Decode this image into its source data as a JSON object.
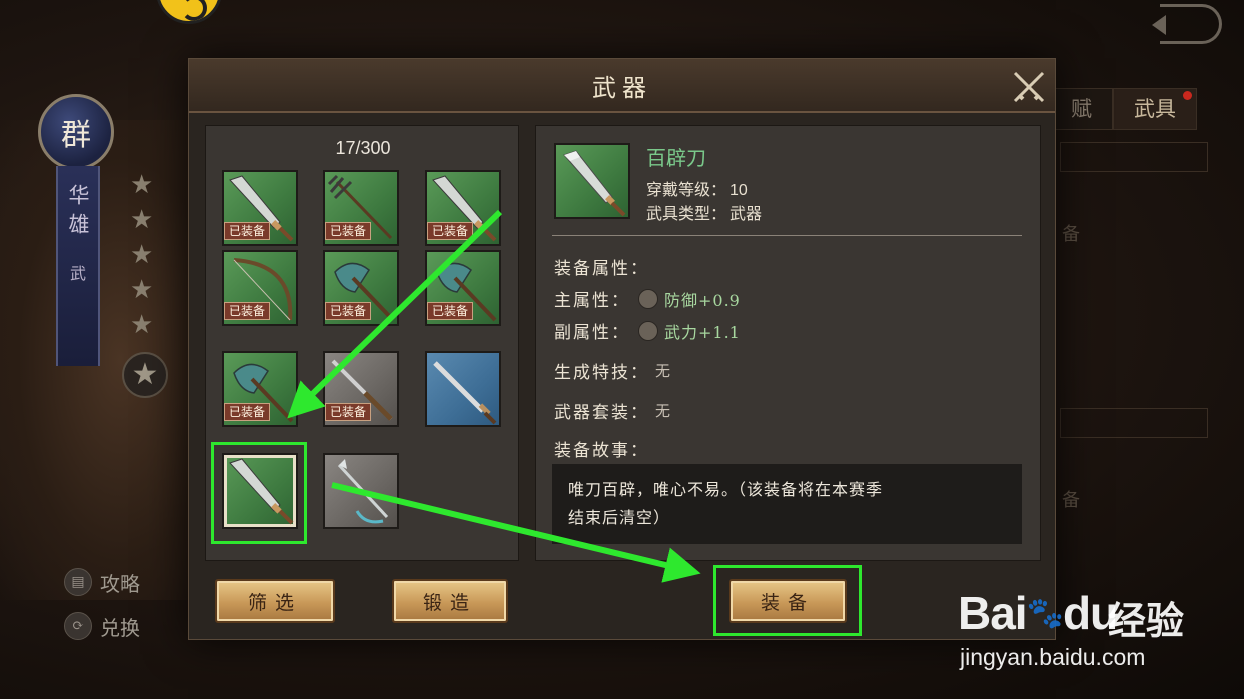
{
  "background": {
    "faction": "群",
    "hero_name": "华雄",
    "hero_type": "武",
    "star_count": 5,
    "side_menu": [
      {
        "label": "攻略",
        "icon": "book-icon"
      },
      {
        "label": "兑换",
        "icon": "exchange-icon"
      }
    ],
    "right_tabs": [
      {
        "label": "赋",
        "active": false
      },
      {
        "label": "武具",
        "active": true
      }
    ],
    "right_faint_texts": [
      "备",
      "备"
    ]
  },
  "dialog": {
    "title": "武器",
    "inventory": {
      "count": "17/300",
      "equipped_tag": "已装备",
      "slots": [
        {
          "weapon": "blade",
          "rarity": "green",
          "equipped": true
        },
        {
          "weapon": "trident",
          "rarity": "green",
          "equipped": true
        },
        {
          "weapon": "blade",
          "rarity": "green",
          "equipped": true
        },
        {
          "weapon": "bow",
          "rarity": "green",
          "equipped": true
        },
        {
          "weapon": "axe",
          "rarity": "green",
          "equipped": true
        },
        {
          "weapon": "axe",
          "rarity": "green",
          "equipped": true
        },
        {
          "weapon": "axe",
          "rarity": "green",
          "equipped": true
        },
        {
          "weapon": "spear",
          "rarity": "gray",
          "equipped": true
        },
        {
          "weapon": "sword",
          "rarity": "blue",
          "equipped": false
        },
        {
          "weapon": "blade",
          "rarity": "green",
          "equipped": false,
          "selected": true
        },
        {
          "weapon": "hook-spear",
          "rarity": "gray",
          "equipped": false
        }
      ]
    },
    "detail": {
      "name": "百辟刀",
      "level_label": "穿戴等级：",
      "level_value": "10",
      "type_label": "武具类型：",
      "type_value": "武器",
      "attributes_label": "装备属性：",
      "main_attr_label": "主属性：",
      "main_attr_value": "防御+0.9",
      "sub_attr_label": "副属性：",
      "sub_attr_value": "武力+1.1",
      "skill_label": "生成特技：",
      "skill_value": "无",
      "set_label": "武器套装：",
      "set_value": "无",
      "story_label": "装备故事：",
      "story_line1": "唯刀百辟，唯心不易。（该装备将在本赛季",
      "story_line2": "结束后清空）"
    },
    "buttons": {
      "filter": "筛选",
      "forge": "锻造",
      "equip": "装备"
    }
  },
  "annotation_color": "#2ee82e",
  "watermark": {
    "brand": "Bai",
    "brand_du": "du",
    "cn": "经验",
    "url": "jingyan.baidu.com"
  }
}
